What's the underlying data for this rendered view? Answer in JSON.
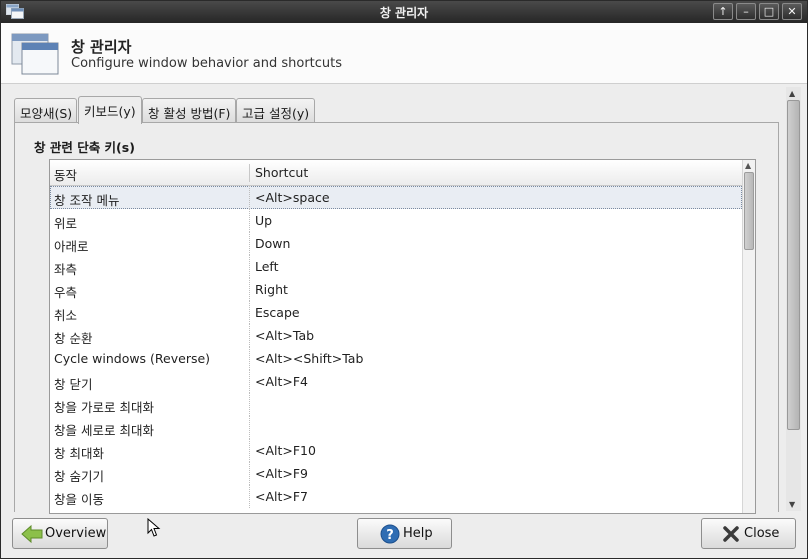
{
  "window": {
    "title": "창 관리자"
  },
  "titlebar_buttons": {
    "up": "↑",
    "minimize": "–",
    "maximize": "□",
    "close": "✕"
  },
  "header": {
    "title": "창 관리자",
    "subtitle": "Configure window behavior and shortcuts"
  },
  "tabs": [
    {
      "label": "모양새(S)"
    },
    {
      "label": "키보드(y)"
    },
    {
      "label": "창 활성 방법(F)"
    },
    {
      "label": "고급 설정(y)"
    }
  ],
  "active_tab": "키보드(y)",
  "section": {
    "label": "창 관련 단축 키(s)"
  },
  "table": {
    "columns": [
      "동작",
      "Shortcut"
    ],
    "rows": [
      {
        "action": "창 조작 메뉴",
        "shortcut": "<Alt>space"
      },
      {
        "action": "위로",
        "shortcut": "Up"
      },
      {
        "action": "아래로",
        "shortcut": "Down"
      },
      {
        "action": "좌측",
        "shortcut": "Left"
      },
      {
        "action": "우측",
        "shortcut": "Right"
      },
      {
        "action": "취소",
        "shortcut": "Escape"
      },
      {
        "action": "창 순환",
        "shortcut": "<Alt>Tab"
      },
      {
        "action": "Cycle windows (Reverse)",
        "shortcut": "<Alt><Shift>Tab"
      },
      {
        "action": "창 닫기",
        "shortcut": "<Alt>F4"
      },
      {
        "action": "창을 가로로 최대화",
        "shortcut": ""
      },
      {
        "action": "창을 세로로 최대화",
        "shortcut": ""
      },
      {
        "action": "창 최대화",
        "shortcut": "<Alt>F10"
      },
      {
        "action": "창 숨기기",
        "shortcut": "<Alt>F9"
      },
      {
        "action": "창을 이동",
        "shortcut": "<Alt>F7"
      }
    ]
  },
  "buttons": {
    "overview": "Overview",
    "help": "Help",
    "close": "Close"
  },
  "colors": {
    "titlebar": "#262626",
    "selection": "#e9edf3",
    "help_icon": "#2f6db3",
    "overview_arrow": "#7fb13a"
  }
}
